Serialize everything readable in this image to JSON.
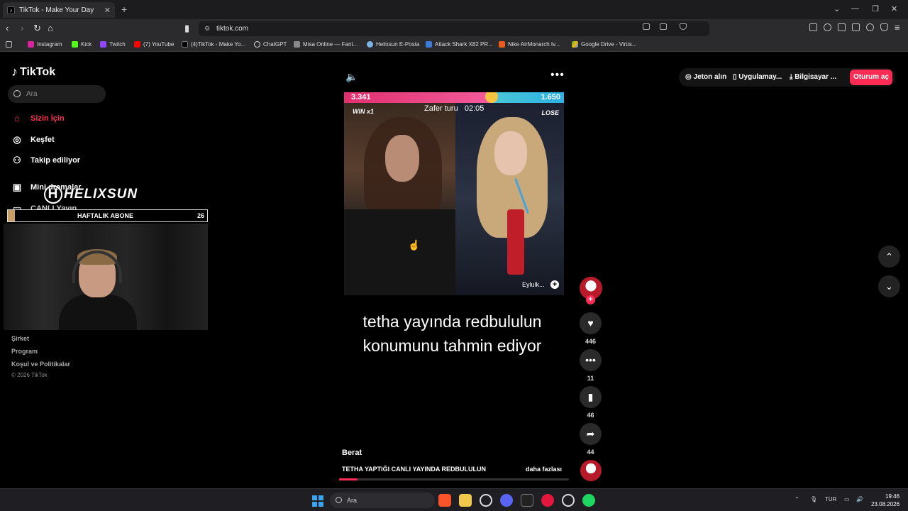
{
  "browser": {
    "tab_title": "TikTok - Make Your Day",
    "url": "tiktok.com",
    "bookmarks": [
      "Instagram",
      "Kick",
      "Twitch",
      "(7) YouTube",
      "(4)TikTok - Make Yo...",
      "ChatGPT",
      "Misa Online — Fant...",
      "Helixsun E-Posta",
      "Attack Shark X82 PR...",
      "Nike AirMonarch Iv...",
      "Google Drive - Virüs..."
    ]
  },
  "sidebar": {
    "logo": "TikTok",
    "search_placeholder": "Ara",
    "nav": [
      "Sizin İçin",
      "Keşfet",
      "Takip ediliyor",
      "Mini dramalar",
      "CANLI Yayın"
    ],
    "footer": [
      "Şirket",
      "Program",
      "Koşul ve Politikalar"
    ],
    "copyright": "© 2026 TikTok"
  },
  "stream_overlay": {
    "brand": "HELIXSUN",
    "sub_label": "HAFTALIK ABONE",
    "sub_count": "26"
  },
  "video": {
    "score_left": "3.341",
    "score_right": "1.650",
    "win_label": "WIN x1",
    "lose_label": "LOSE",
    "timer_label": "Zafer turu",
    "timer_value": "02:05",
    "opponent": "Eylulk...",
    "caption": "tetha yayında redbululun konumunu tahmin ediyor",
    "author": "Berat",
    "description": "TETHA YAPTIĞI CANLI YAYINDA REDBULULUN",
    "more_label": "daha fazlası",
    "progress": 0.08
  },
  "actions": {
    "likes": "446",
    "comments": "11",
    "saves": "46",
    "shares": "44"
  },
  "topbar": {
    "coins": "Jeton alın",
    "app": "Uygulamay...",
    "pc": "Bilgisayar ...",
    "login": "Oturum aç"
  },
  "taskbar": {
    "search": "Ara",
    "lang": "TUR",
    "time": "19:46",
    "date": "23.08.2026"
  },
  "colors": {
    "accent": "#fe2c55",
    "score_pink": "#e0306f",
    "score_cyan": "#2ab2e5"
  }
}
